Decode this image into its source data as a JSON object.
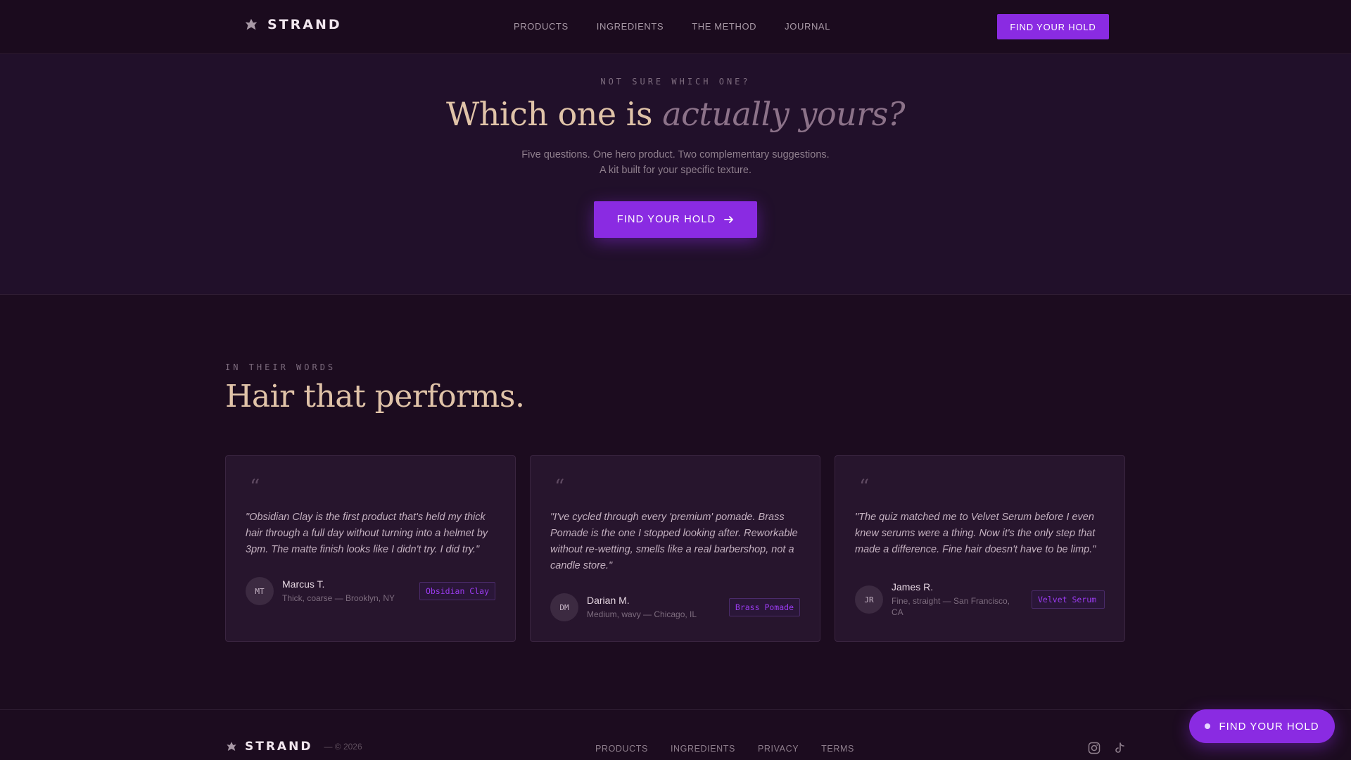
{
  "nav": {
    "brand": "STRAND",
    "links": [
      "PRODUCTS",
      "INGREDIENTS",
      "THE METHOD",
      "JOURNAL"
    ],
    "cta": "FIND YOUR HOLD"
  },
  "hero": {
    "eyebrow": "NOT SURE WHICH ONE?",
    "title_plain": "Which one is ",
    "title_italic": "actually yours?",
    "subtitle": "Five questions. One hero product. Two complementary suggestions. A kit built for your specific texture.",
    "cta": "FIND YOUR HOLD"
  },
  "testimonials": {
    "eyebrow": "IN THEIR WORDS",
    "title": "Hair that performs.",
    "quote_mark": "“",
    "items": [
      {
        "quote": "\"Obsidian Clay is the first product that's held my thick hair through a full day without turning into a helmet by 3pm. The matte finish looks like I didn't try. I did try.\"",
        "initials": "MT",
        "name": "Marcus T.",
        "meta": "Thick, coarse — Brooklyn, NY",
        "product": "Obsidian Clay"
      },
      {
        "quote": "\"I've cycled through every 'premium' pomade. Brass Pomade is the one I stopped looking after. Reworkable without re-wetting, smells like a real barbershop, not a candle store.\"",
        "initials": "DM",
        "name": "Darian M.",
        "meta": "Medium, wavy — Chicago, IL",
        "product": "Brass Pomade"
      },
      {
        "quote": "\"The quiz matched me to Velvet Serum before I even knew serums were a thing. Now it's the only step that made a difference. Fine hair doesn't have to be limp.\"",
        "initials": "JR",
        "name": "James R.",
        "meta": "Fine, straight — San Francisco, CA",
        "product": "Velvet Serum"
      }
    ]
  },
  "footer": {
    "brand": "STRAND",
    "copyright": "— © 2026",
    "links": [
      "PRODUCTS",
      "INGREDIENTS",
      "PRIVACY",
      "TERMS"
    ],
    "social": [
      "instagram-icon",
      "tiktok-icon"
    ]
  },
  "floating_cta": "FIND YOUR HOLD",
  "colors": {
    "accent": "#8a2be2",
    "background": "#1c0c1f",
    "heading": "#e0c3a8"
  }
}
